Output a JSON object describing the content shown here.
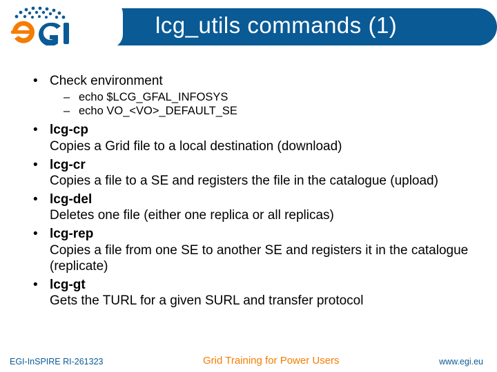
{
  "header": {
    "title": "lcg_utils commands (1)"
  },
  "body": {
    "env_heading": "Check environment",
    "env_lines": [
      "echo $LCG_GFAL_INFOSYS",
      "echo VO_<VO>_DEFAULT_SE"
    ],
    "commands": [
      {
        "name": "lcg-cp",
        "desc": "Copies a Grid file to a local destination (download)"
      },
      {
        "name": "lcg-cr",
        "desc": "Copies a file to a SE and registers the file in the catalogue (upload)"
      },
      {
        "name": "lcg-del",
        "desc": "Deletes one file (either one replica or all replicas)"
      },
      {
        "name": "lcg-rep",
        "desc": "Copies a file from one SE to another SE and registers it in the catalogue (replicate)"
      },
      {
        "name": "lcg-gt",
        "desc": "Gets the TURL for a given SURL and transfer protocol"
      }
    ]
  },
  "footer": {
    "left": "EGI-InSPIRE RI-261323",
    "center": "Grid Training for Power Users",
    "right": "www.egi.eu"
  },
  "brand": {
    "primary": "#0a5a96",
    "accent": "#f57c00",
    "logo_text": "eGI"
  }
}
